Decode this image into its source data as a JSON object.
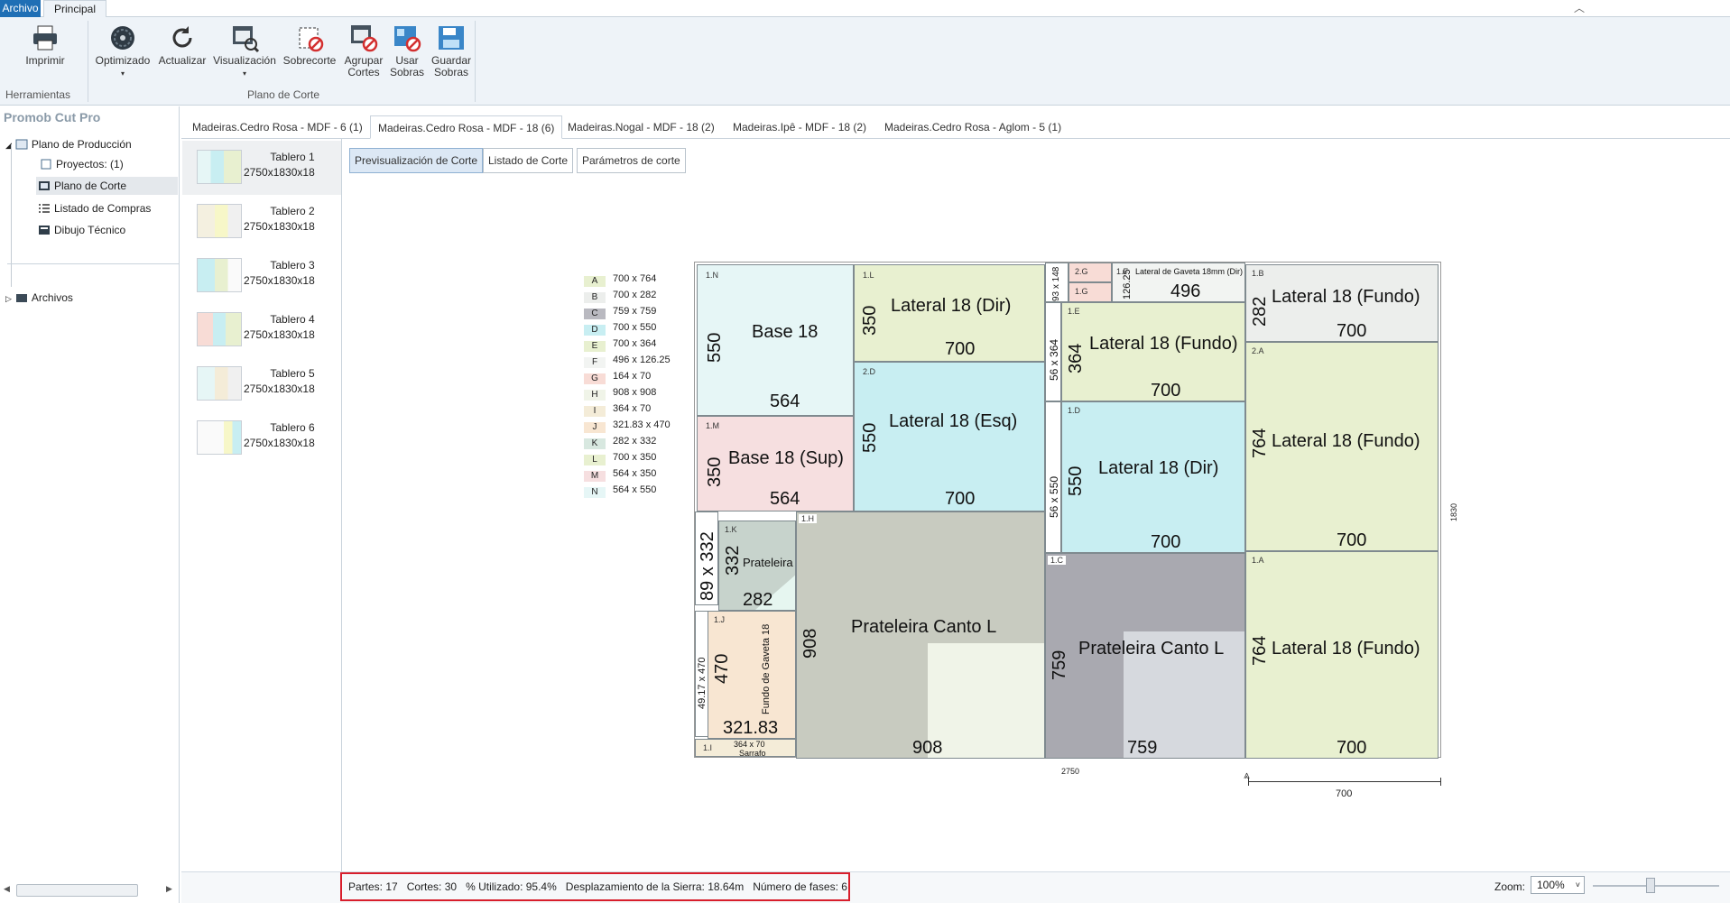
{
  "menu": {
    "archivo": "Archivo",
    "principal": "Principal"
  },
  "ribbon": {
    "buttons": [
      {
        "label": "Imprimir",
        "icon": "printer-icon"
      },
      {
        "label": "Optimizado",
        "icon": "saw-blade-icon"
      },
      {
        "label": "Actualizar",
        "icon": "refresh-icon"
      },
      {
        "label": "Visualización",
        "icon": "visualize-icon"
      },
      {
        "label": "Sobrecorte",
        "icon": "overcut-icon"
      },
      {
        "label": "Agrupar Cortes",
        "icon": "group-cuts-icon"
      },
      {
        "label": "Usar Sobras",
        "icon": "use-leftovers-icon"
      },
      {
        "label": "Guardar Sobras",
        "icon": "save-leftovers-icon"
      }
    ],
    "groups": [
      "Herramientas",
      "Plano de Corte"
    ]
  },
  "sidebar": {
    "title": "Promob Cut Pro",
    "items": [
      {
        "label": "Plano de Producción",
        "icon": "production-plan-icon"
      },
      {
        "label": "Proyectos: (1)",
        "icon": "projects-icon"
      },
      {
        "label": "Plano de Corte",
        "icon": "cut-plan-icon"
      },
      {
        "label": "Listado de Compras",
        "icon": "list-icon"
      },
      {
        "label": "Dibujo Técnico",
        "icon": "technical-drawing-icon"
      },
      {
        "label": "Archivos",
        "icon": "folder-icon"
      }
    ]
  },
  "tabs": [
    "Madeiras.Cedro Rosa - MDF - 6 (1)",
    "Madeiras.Cedro Rosa - MDF - 18 (6)",
    "Madeiras.Nogal - MDF - 18 (2)",
    "Madeiras.Ipê - MDF - 18 (2)",
    "Madeiras.Cedro Rosa - Aglom - 5 (1)"
  ],
  "boards": [
    {
      "name": "Tablero 1",
      "dim": "2750x1830x18"
    },
    {
      "name": "Tablero 2",
      "dim": "2750x1830x18"
    },
    {
      "name": "Tablero 3",
      "dim": "2750x1830x18"
    },
    {
      "name": "Tablero 4",
      "dim": "2750x1830x18"
    },
    {
      "name": "Tablero 5",
      "dim": "2750x1830x18"
    },
    {
      "name": "Tablero 6",
      "dim": "2750x1830x18"
    }
  ],
  "subtabs": [
    "Previsualización de Corte",
    "Listado de Corte",
    "Parámetros de corte"
  ],
  "legend": [
    {
      "code": "A",
      "size": "700 x 764",
      "color": "#e8f0d0"
    },
    {
      "code": "B",
      "size": "700 x 282",
      "color": "#eceeec"
    },
    {
      "code": "C",
      "size": "759 x 759",
      "color": "#b9b9c0"
    },
    {
      "code": "D",
      "size": "700 x 550",
      "color": "#c8eef2"
    },
    {
      "code": "E",
      "size": "700 x 364",
      "color": "#e8f0d0"
    },
    {
      "code": "F",
      "size": "496 x 126.25",
      "color": "#f2f4f2"
    },
    {
      "code": "G",
      "size": "164 x 70",
      "color": "#f8dcd6"
    },
    {
      "code": "H",
      "size": "908 x 908",
      "color": "#f0f4e8"
    },
    {
      "code": "I",
      "size": "364 x 70",
      "color": "#f4ecd8"
    },
    {
      "code": "J",
      "size": "321.83 x 470",
      "color": "#f8e6d2"
    },
    {
      "code": "K",
      "size": "282 x 332",
      "color": "#d8e8e0"
    },
    {
      "code": "L",
      "size": "700 x 350",
      "color": "#e8f0d0"
    },
    {
      "code": "M",
      "size": "564 x 350",
      "color": "#f6dfe0"
    },
    {
      "code": "N",
      "size": "564 x 550",
      "color": "#e6f6f6"
    }
  ],
  "plan": {
    "pieces": {
      "p1N": {
        "id": "1.N",
        "name": "Base 18",
        "w": "564",
        "h": "550"
      },
      "p1M": {
        "id": "1.M",
        "name": "Base 18 (Sup)",
        "w": "564",
        "h": "350"
      },
      "p1L": {
        "id": "1.L",
        "name": "Lateral 18 (Dir)",
        "w": "700",
        "h": "350"
      },
      "p2D": {
        "id": "2.D",
        "name": "Lateral 18 (Esq)",
        "w": "700",
        "h": "550"
      },
      "p1K": {
        "id": "1.K",
        "name": "Prateleira",
        "w": "282",
        "h": "332"
      },
      "p1J": {
        "id": "1.J",
        "name": "Fundo de Gaveta 18",
        "w": "321.83",
        "h": "470"
      },
      "p1I": {
        "id": "1.I",
        "size": "364 x 70",
        "name": "Sarrafo"
      },
      "p1H": {
        "id": "1.H",
        "name": "Prateleira Canto L",
        "w": "908",
        "h": "908"
      },
      "p2G": {
        "id": "2.G"
      },
      "p1G": {
        "id": "1.G"
      },
      "p1F": {
        "id": "1.F",
        "name": "Lateral de Gaveta 18mm (Dir)",
        "w": "496",
        "h": "126.25"
      },
      "p1E": {
        "id": "1.E",
        "name": "Lateral 18 (Fundo)",
        "w": "700",
        "h": "364"
      },
      "p1D": {
        "id": "1.D",
        "name": "Lateral 18 (Dir)",
        "w": "700",
        "h": "550"
      },
      "p1C": {
        "id": "1.C",
        "name": "Prateleira Canto L",
        "w": "759",
        "h": "759"
      },
      "p1B": {
        "id": "1.B",
        "name": "Lateral 18 (Fundo)",
        "w": "700",
        "h": "282"
      },
      "p2A": {
        "id": "2.A",
        "name": "Lateral 18 (Fundo)",
        "w": "700",
        "h": "764"
      },
      "p1A": {
        "id": "1.A",
        "name": "Lateral 18 (Fundo)",
        "w": "700",
        "h": "764"
      }
    },
    "scraps": {
      "s1": "89 x 332",
      "s2": "49.17 x 470",
      "s3": "93 x 148",
      "s4": "56 x 364",
      "s5": "56 x 550"
    },
    "board_width": "2750",
    "board_height": "1830",
    "measure": "700"
  },
  "status": {
    "parts": "Partes: 17",
    "cuts": "Cortes: 30",
    "used": "% Utilizado: 95.4%",
    "saw": "Desplazamiento de la Sierra: 18.64m",
    "phases": "Número de fases: 6"
  },
  "zoom": {
    "label": "Zoom:",
    "value": "100%"
  }
}
